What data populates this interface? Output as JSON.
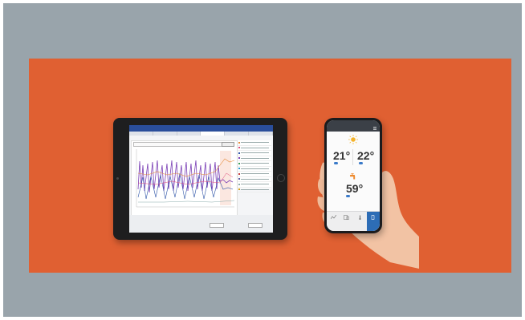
{
  "colors": {
    "frame": "#99a4ab",
    "banner": "#e06032",
    "tablet_nav": "#2a4e9b",
    "phone_header": "#3b4047",
    "phone_accent": "#2d6db6"
  },
  "tablet": {
    "nav_title": "",
    "tabs": [
      "",
      "",
      "",
      "",
      "",
      ""
    ],
    "meta": "",
    "chart_title": "",
    "chart_button": "",
    "footer_buttons": [
      "",
      ""
    ]
  },
  "phone": {
    "status_time": "",
    "app_title": "",
    "weather": "",
    "zones": [
      {
        "label": "",
        "temp": "21°",
        "sub": ""
      },
      {
        "label": "",
        "temp": "22°",
        "sub": ""
      }
    ],
    "hot_water": {
      "temp": "59°",
      "sub": ""
    },
    "tabs": [
      {
        "icon": "graph-icon",
        "label": ""
      },
      {
        "icon": "devices-icon",
        "label": ""
      },
      {
        "icon": "thermostat-icon",
        "label": ""
      },
      {
        "icon": "phone-icon",
        "label": ""
      }
    ]
  }
}
